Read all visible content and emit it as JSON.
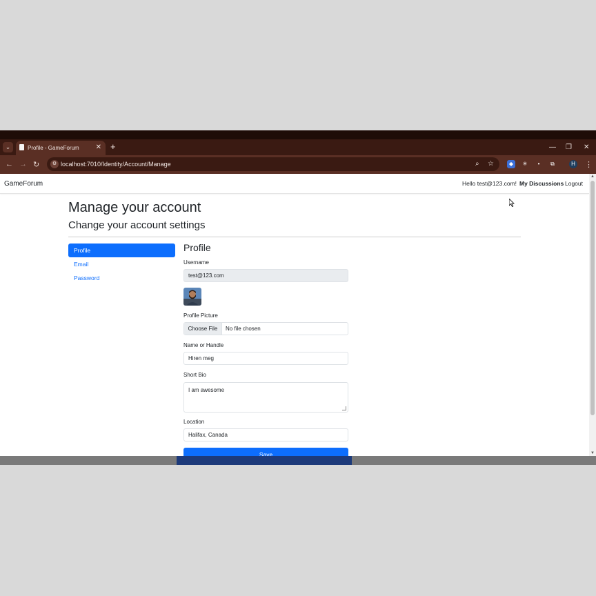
{
  "browser": {
    "tab_title": "Profile - GameForum",
    "tab_close": "✕",
    "new_tab": "+",
    "url": "localhost:7010/Identity/Account/Manage",
    "profile_initial": "H",
    "window_controls": {
      "minimize": "—",
      "restore": "❐",
      "close": "✕"
    }
  },
  "navbar": {
    "brand": "GameForum",
    "hello": "Hello test@123.com!",
    "my_discussions": "My Discussions",
    "logout": "Logout"
  },
  "page": {
    "title": "Manage your account",
    "subtitle": "Change your account settings"
  },
  "sidebar": {
    "items": [
      {
        "label": "Profile",
        "active": true
      },
      {
        "label": "Email",
        "active": false
      },
      {
        "label": "Password",
        "active": false
      }
    ]
  },
  "form": {
    "heading": "Profile",
    "username_label": "Username",
    "username_value": "test@123.com",
    "picture_label": "Profile Picture",
    "file_button": "Choose File",
    "file_status": "No file chosen",
    "name_label": "Name or Handle",
    "name_value": "Hiren meg",
    "bio_label": "Short Bio",
    "bio_value": "I am awesome",
    "location_label": "Location",
    "location_value": "Halifax, Canada",
    "save_label": "Save"
  },
  "colors": {
    "primary": "#0d6efd",
    "browser_frame": "#5a2f24",
    "browser_tabbar": "#3a1a12"
  }
}
